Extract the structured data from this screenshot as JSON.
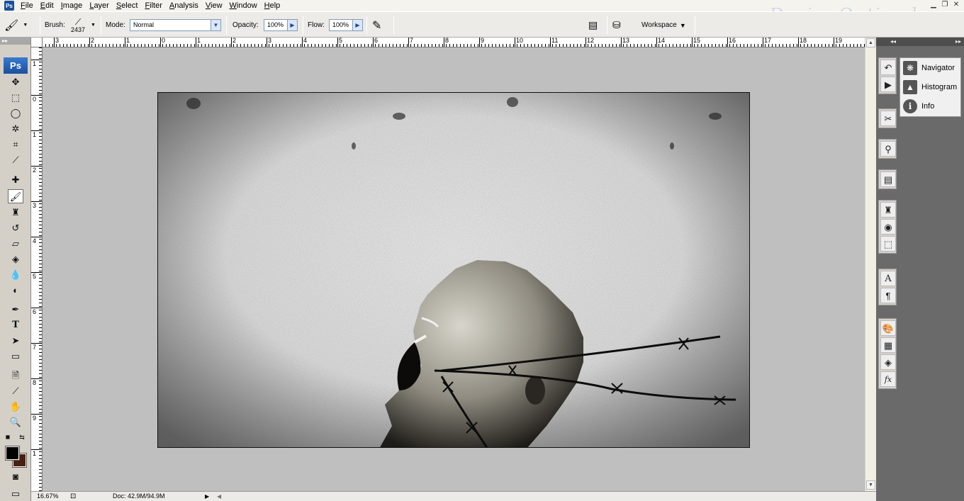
{
  "menubar": {
    "app_icon": "Ps",
    "items": [
      "File",
      "Edit",
      "Image",
      "Layer",
      "Select",
      "Filter",
      "Analysis",
      "View",
      "Window",
      "Help"
    ],
    "watermark": "DesignOptimal.com"
  },
  "options_bar": {
    "brush_label": "Brush:",
    "brush_size": "2437",
    "mode_label": "Mode:",
    "mode_value": "Normal",
    "opacity_label": "Opacity:",
    "opacity_value": "100%",
    "flow_label": "Flow:",
    "flow_value": "100%",
    "workspace_label": "Workspace"
  },
  "ruler": {
    "h_numbers": [
      "3",
      "2",
      "1",
      "0",
      "1",
      "2",
      "3",
      "4",
      "5",
      "6",
      "7",
      "8",
      "9",
      "10",
      "11",
      "12",
      "13",
      "14",
      "15",
      "16",
      "17",
      "18",
      "19"
    ],
    "v_numbers": [
      "1",
      "0",
      "1",
      "2",
      "3",
      "4",
      "5",
      "6",
      "7",
      "8",
      "9",
      "1"
    ]
  },
  "status": {
    "zoom": "16.67%",
    "doc": "Doc: 42.9M/94.9M"
  },
  "colors": {
    "foreground": "#000000",
    "background": "#4a1f10"
  },
  "panels": {
    "items": [
      {
        "label": "Navigator",
        "icon": "navigator-icon"
      },
      {
        "label": "Histogram",
        "icon": "histogram-icon"
      },
      {
        "label": "Info",
        "icon": "info-icon"
      }
    ]
  }
}
